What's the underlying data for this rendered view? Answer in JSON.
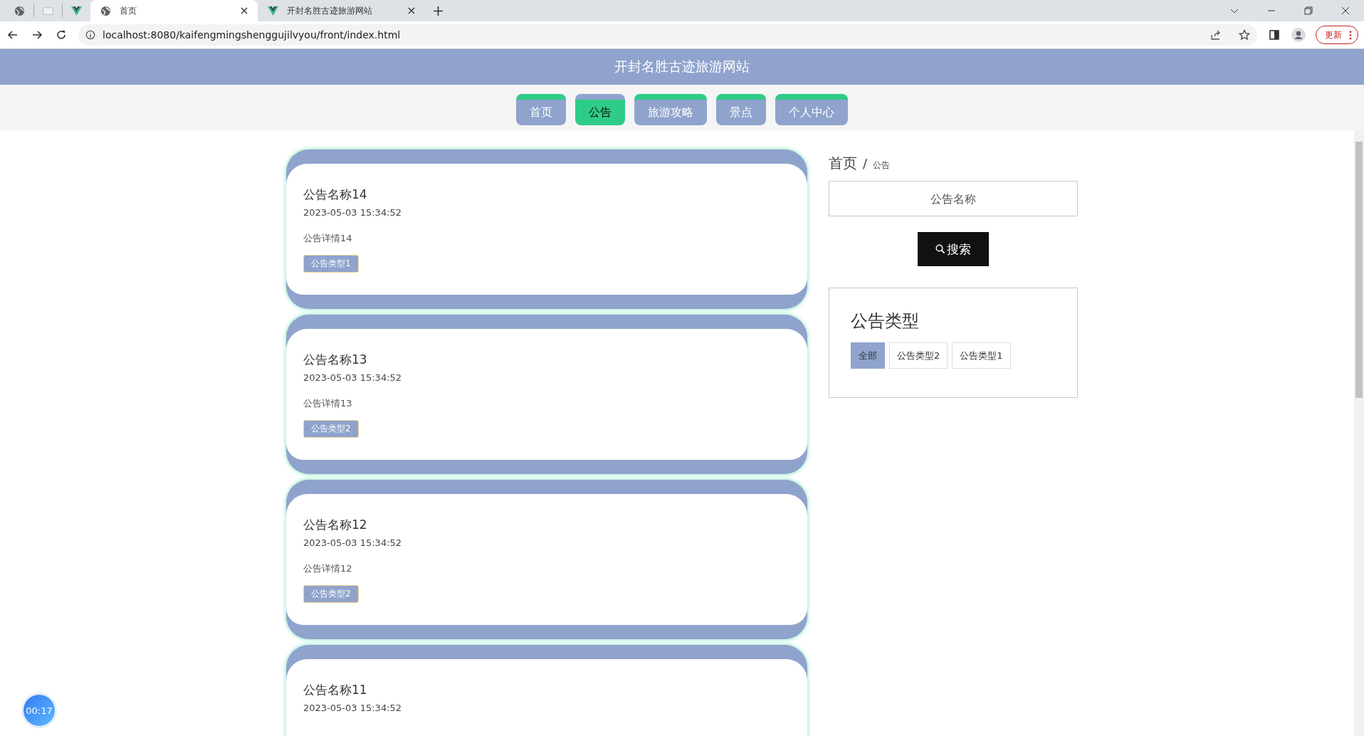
{
  "browser": {
    "tabs": [
      {
        "title": "首页",
        "selected": true
      },
      {
        "title": "开封名胜古迹旅游网站",
        "selected": false
      }
    ],
    "address": "localhost:8080/kaifengmingshenggujilvyou/front/index.html",
    "update_label": "更新"
  },
  "site_title": "开封名胜古迹旅游网站",
  "nav": [
    {
      "label": "首页",
      "selected": false
    },
    {
      "label": "公告",
      "selected": true
    },
    {
      "label": "旅游攻略",
      "selected": false
    },
    {
      "label": "景点",
      "selected": false
    },
    {
      "label": "个人中心",
      "selected": false
    }
  ],
  "notices": [
    {
      "title": "公告名称14",
      "time": "2023-05-03 15:34:52",
      "detail": "公告详情14",
      "type": "公告类型1"
    },
    {
      "title": "公告名称13",
      "time": "2023-05-03 15:34:52",
      "detail": "公告详情13",
      "type": "公告类型2"
    },
    {
      "title": "公告名称12",
      "time": "2023-05-03 15:34:52",
      "detail": "公告详情12",
      "type": "公告类型2"
    },
    {
      "title": "公告名称11",
      "time": "2023-05-03 15:34:52"
    }
  ],
  "breadcrumb": {
    "home": "首页",
    "separator": "/",
    "current": "公告"
  },
  "search": {
    "placeholder": "公告名称",
    "button": "搜索"
  },
  "filter": {
    "title": "公告类型",
    "options": [
      {
        "label": "全部",
        "selected": true
      },
      {
        "label": "公告类型2",
        "selected": false
      },
      {
        "label": "公告类型1",
        "selected": false
      }
    ]
  },
  "timer": "00:17"
}
